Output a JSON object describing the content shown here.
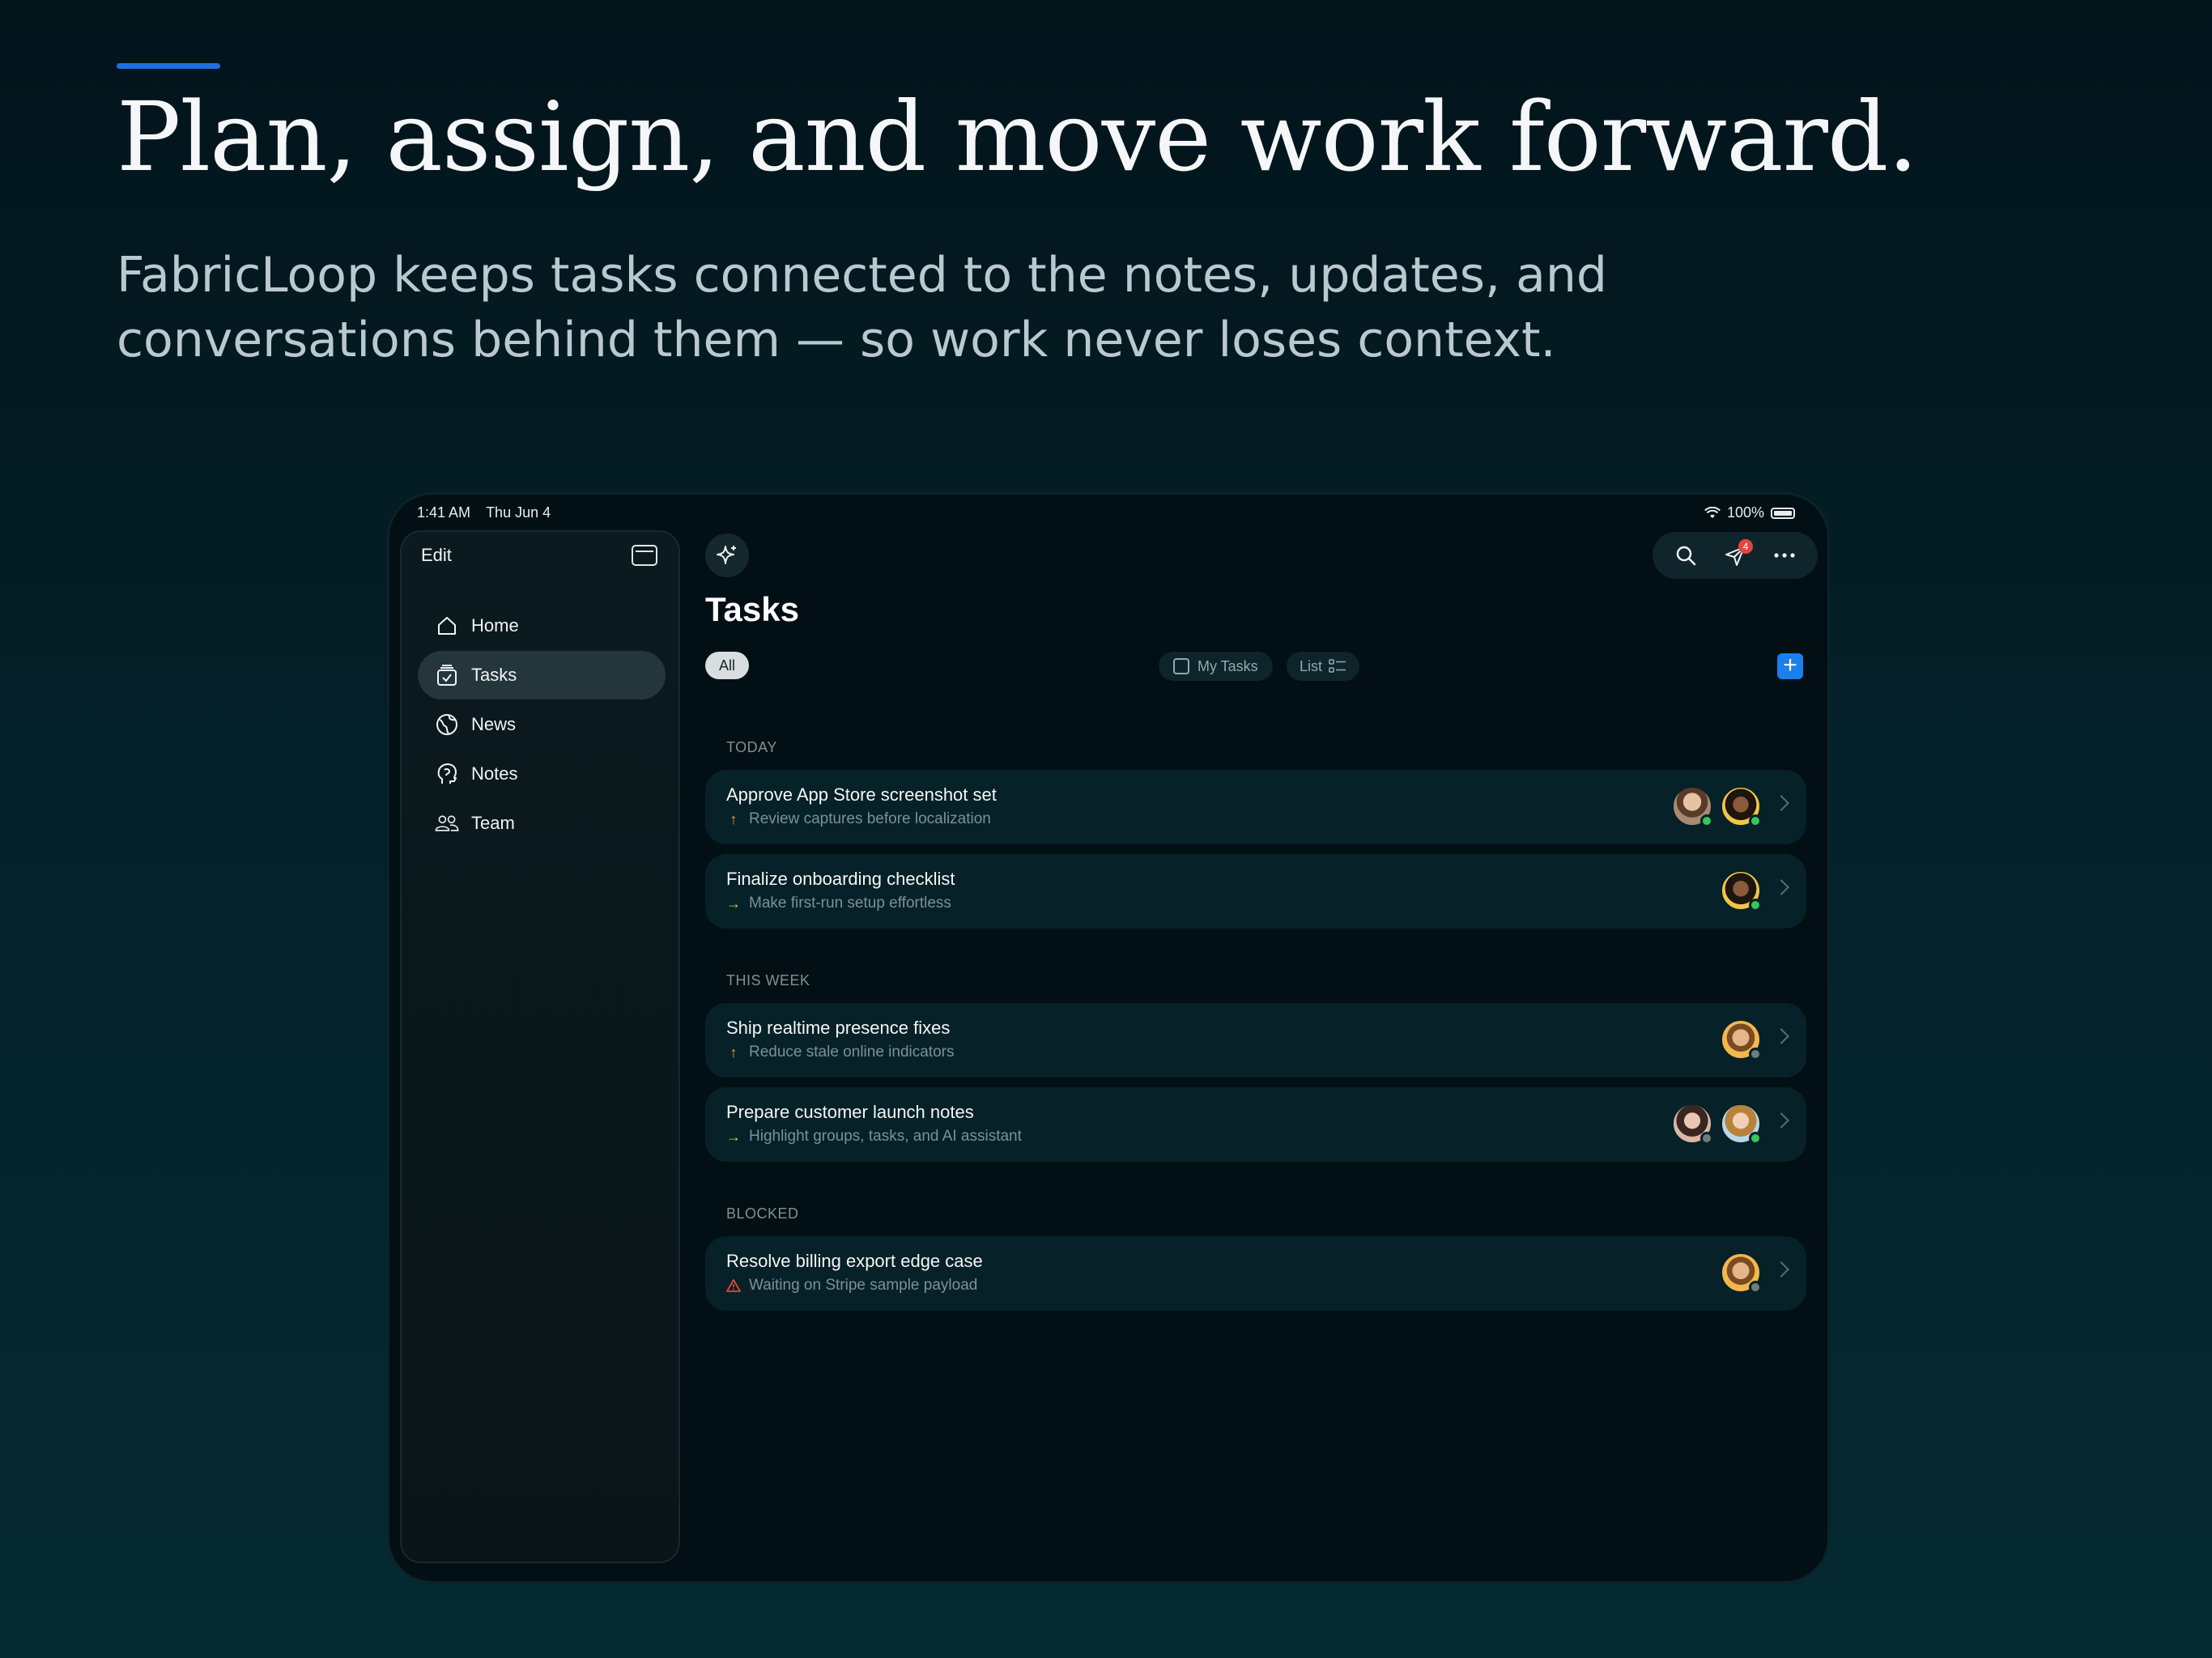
{
  "hero": {
    "headline": "Plan, assign, and move work forward.",
    "subhead": "FabricLoop keeps tasks connected to the notes, updates, and conversations behind them — so work never loses context."
  },
  "status": {
    "time": "1:41 AM",
    "date": "Thu Jun 4",
    "battery": "100%"
  },
  "sidebar": {
    "edit_label": "Edit",
    "items": [
      {
        "label": "Home",
        "icon": "home-icon",
        "active": false
      },
      {
        "label": "Tasks",
        "icon": "tasks-icon",
        "active": true
      },
      {
        "label": "News",
        "icon": "globe-icon",
        "active": false
      },
      {
        "label": "Notes",
        "icon": "brain-icon",
        "active": false
      },
      {
        "label": "Team",
        "icon": "people-icon",
        "active": false
      }
    ]
  },
  "toolbar": {
    "notification_count": "4"
  },
  "main": {
    "title": "Tasks",
    "filter_all": "All",
    "filter_my_tasks": "My Tasks",
    "view_mode": "List"
  },
  "sections": [
    {
      "label": "TODAY",
      "tasks": [
        {
          "title": "Approve App Store screenshot set",
          "subtitle": "Review captures before localization",
          "priority": "high",
          "avatars": [
            {
              "color": "#c9a27e",
              "status": "#34c759"
            },
            {
              "color": "#f3c547",
              "status": "#34c759"
            }
          ]
        },
        {
          "title": "Finalize onboarding checklist",
          "subtitle": "Make first-run setup effortless",
          "priority": "medium",
          "avatars": [
            {
              "color": "#f3c547",
              "status": "#34c759"
            }
          ]
        }
      ]
    },
    {
      "label": "THIS WEEK",
      "tasks": [
        {
          "title": "Ship realtime presence fixes",
          "subtitle": "Reduce stale online indicators",
          "priority": "high",
          "avatars": [
            {
              "color": "#f2b84b",
              "status": "#6e7c80"
            }
          ]
        },
        {
          "title": "Prepare customer launch notes",
          "subtitle": "Highlight groups, tasks, and AI assistant",
          "priority": "medium",
          "avatars": [
            {
              "color": "#d9b8a6",
              "status": "#6e7c80"
            },
            {
              "color": "#b9d7e8",
              "status": "#34c759"
            }
          ]
        }
      ]
    },
    {
      "label": "BLOCKED",
      "tasks": [
        {
          "title": "Resolve billing export edge case",
          "subtitle": "Waiting on Stripe sample payload",
          "priority": "blocked",
          "avatars": [
            {
              "color": "#f2b84b",
              "status": "#6e7c80"
            }
          ]
        }
      ]
    }
  ],
  "colors": {
    "accent": "#1f6fe0",
    "add_button": "#1980ec",
    "priority_high": "#f0a23a",
    "priority_medium": "#e8c93a",
    "priority_blocked": "#e2463e",
    "online": "#34c759"
  }
}
